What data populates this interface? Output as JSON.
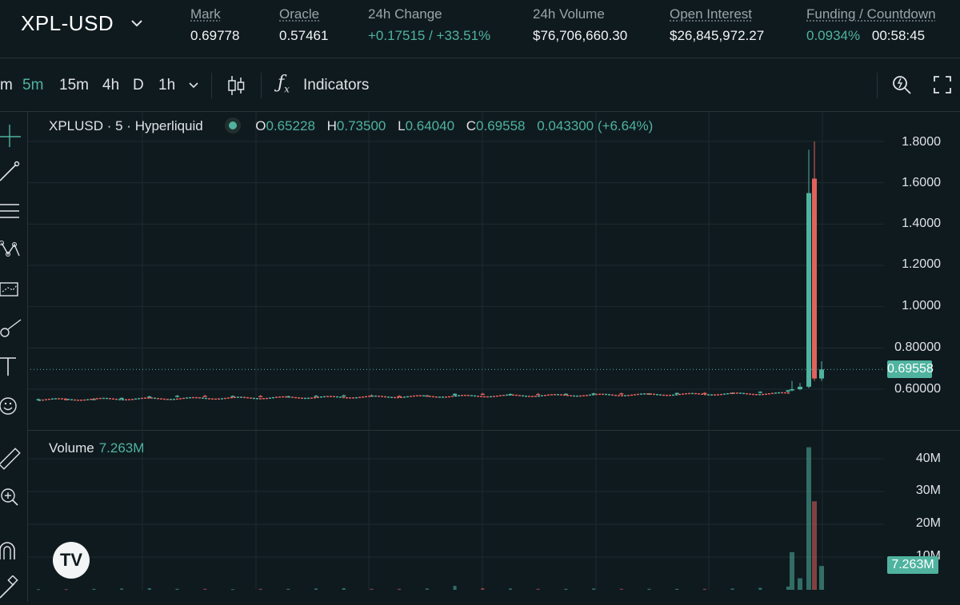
{
  "header": {
    "symbol": "XPL-USD",
    "stats": [
      {
        "label": "Mark",
        "value": "0.69778",
        "tone": "plain"
      },
      {
        "label": "Oracle",
        "value": "0.57461",
        "tone": "plain"
      },
      {
        "label": "24h Change",
        "value": "+0.17515 / +33.51%",
        "tone": "up"
      },
      {
        "label": "24h Volume",
        "value": "$76,706,660.30",
        "tone": "plain"
      },
      {
        "label": "Open Interest",
        "value": "$26,845,972.27",
        "tone": "plain"
      },
      {
        "label": "Funding / Countdown",
        "value": "0.0934%",
        "value2": "00:58:45",
        "tone": "up"
      }
    ]
  },
  "toolbar": {
    "timeframes": [
      "m",
      "5m",
      "15m",
      "4h",
      "D",
      "1h"
    ],
    "active_timeframe": "5m",
    "indicators_label": "Indicators"
  },
  "legend": {
    "title": "XPLUSD · 5 · Hyperliquid",
    "o_key": "O",
    "o": "0.65228",
    "h_key": "H",
    "h": "0.73500",
    "l_key": "L",
    "l": "0.64040",
    "c_key": "C",
    "c": "0.69558",
    "change": "0.043300 (+6.64%)"
  },
  "volume": {
    "label": "Volume",
    "value": "7.263M",
    "axis_ticks": [
      "40M",
      "30M",
      "20M",
      "10M"
    ]
  },
  "price_axis": {
    "ticks": [
      "1.8000",
      "1.6000",
      "1.4000",
      "1.2000",
      "1.0000",
      "0.80000",
      "0.60000"
    ],
    "last_price": "0.69558"
  },
  "colors": {
    "up": "#4fb39f",
    "down": "#e0625d",
    "background": "#0f1a1f",
    "grid": "#1d2a2f"
  },
  "chart_data": {
    "type": "candlestick",
    "interval": "5m",
    "ylim": [
      0.5,
      1.85
    ],
    "price_series": [
      {
        "o": 0.55,
        "h": 0.555,
        "l": 0.545,
        "c": 0.552
      },
      {
        "o": 0.552,
        "h": 0.556,
        "l": 0.548,
        "c": 0.551
      },
      {
        "o": 0.551,
        "h": 0.555,
        "l": 0.547,
        "c": 0.553
      },
      {
        "o": 0.553,
        "h": 0.56,
        "l": 0.55,
        "c": 0.558
      },
      {
        "o": 0.558,
        "h": 0.568,
        "l": 0.556,
        "c": 0.565
      },
      {
        "o": 0.565,
        "h": 0.572,
        "l": 0.56,
        "c": 0.568
      },
      {
        "o": 0.568,
        "h": 0.573,
        "l": 0.563,
        "c": 0.566
      },
      {
        "o": 0.566,
        "h": 0.57,
        "l": 0.562,
        "c": 0.567
      },
      {
        "o": 0.567,
        "h": 0.572,
        "l": 0.562,
        "c": 0.565
      },
      {
        "o": 0.565,
        "h": 0.569,
        "l": 0.56,
        "c": 0.566
      },
      {
        "o": 0.566,
        "h": 0.572,
        "l": 0.562,
        "c": 0.568
      },
      {
        "o": 0.568,
        "h": 0.574,
        "l": 0.565,
        "c": 0.57
      },
      {
        "o": 0.57,
        "h": 0.575,
        "l": 0.566,
        "c": 0.567
      },
      {
        "o": 0.567,
        "h": 0.571,
        "l": 0.563,
        "c": 0.566
      },
      {
        "o": 0.566,
        "h": 0.572,
        "l": 0.564,
        "c": 0.57
      },
      {
        "o": 0.57,
        "h": 0.58,
        "l": 0.568,
        "c": 0.578
      },
      {
        "o": 0.578,
        "h": 0.583,
        "l": 0.572,
        "c": 0.575
      },
      {
        "o": 0.575,
        "h": 0.58,
        "l": 0.571,
        "c": 0.577
      },
      {
        "o": 0.577,
        "h": 0.582,
        "l": 0.573,
        "c": 0.576
      },
      {
        "o": 0.576,
        "h": 0.58,
        "l": 0.572,
        "c": 0.578
      },
      {
        "o": 0.578,
        "h": 0.583,
        "l": 0.575,
        "c": 0.58
      },
      {
        "o": 0.58,
        "h": 0.584,
        "l": 0.576,
        "c": 0.577
      },
      {
        "o": 0.577,
        "h": 0.581,
        "l": 0.574,
        "c": 0.579
      },
      {
        "o": 0.579,
        "h": 0.584,
        "l": 0.576,
        "c": 0.582
      },
      {
        "o": 0.582,
        "h": 0.586,
        "l": 0.578,
        "c": 0.58
      },
      {
        "o": 0.58,
        "h": 0.585,
        "l": 0.577,
        "c": 0.583
      },
      {
        "o": 0.583,
        "h": 0.59,
        "l": 0.58,
        "c": 0.588
      },
      {
        "o": 0.588,
        "h": 0.597,
        "l": 0.585,
        "c": 0.595
      },
      {
        "o": 0.595,
        "h": 0.64,
        "l": 0.59,
        "c": 0.6
      },
      {
        "o": 0.6,
        "h": 0.63,
        "l": 0.595,
        "c": 0.612
      },
      {
        "o": 0.612,
        "h": 1.76,
        "l": 0.605,
        "c": 1.55
      },
      {
        "o": 1.62,
        "h": 1.8,
        "l": 0.64,
        "c": 0.652
      },
      {
        "o": 0.652,
        "h": 0.735,
        "l": 0.6404,
        "c": 0.69558
      }
    ],
    "volume_series_M": [
      0.2,
      0.2,
      0.3,
      0.4,
      0.5,
      0.3,
      0.3,
      0.2,
      0.3,
      0.3,
      0.4,
      0.5,
      0.3,
      0.3,
      0.4,
      1.2,
      0.5,
      0.4,
      0.3,
      0.3,
      0.4,
      0.3,
      0.3,
      0.3,
      0.3,
      0.4,
      0.6,
      1.0,
      11.5,
      3.5,
      43.5,
      27.0,
      7.263
    ]
  }
}
